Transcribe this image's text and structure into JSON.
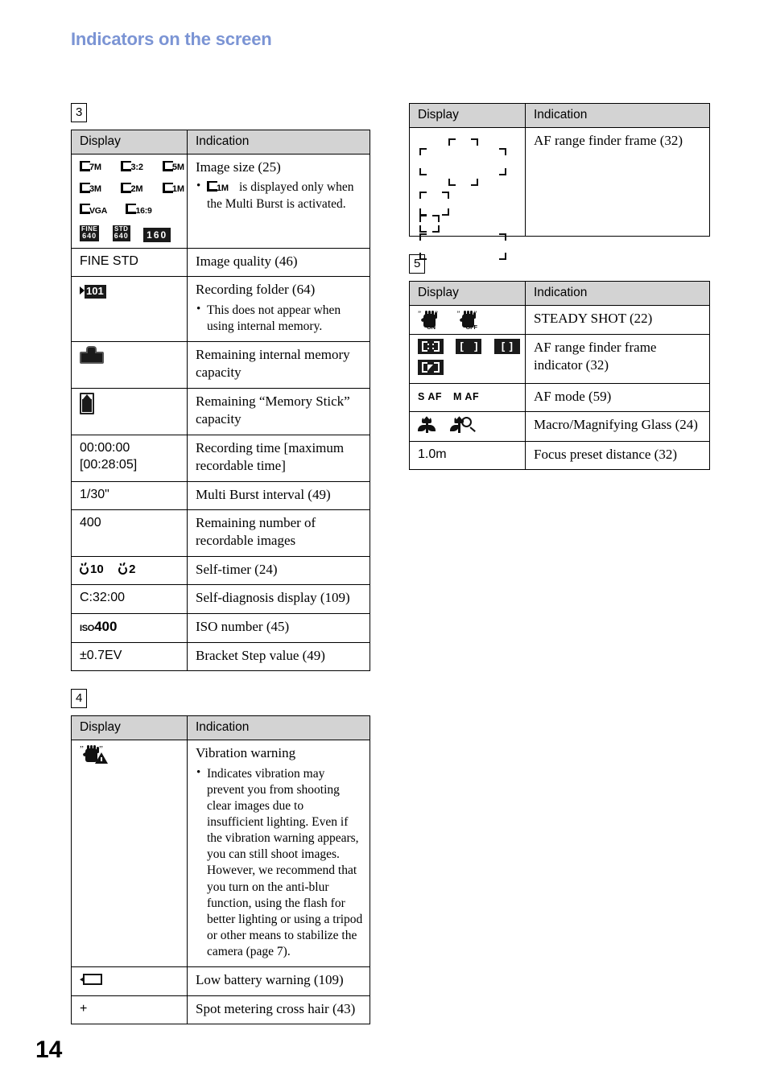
{
  "header": {
    "title": "Indicators on the screen"
  },
  "page_number": "14",
  "accent_color": "#7b94d4",
  "header_row_bg": "#d3d3d3",
  "columns": {
    "headers": {
      "display": "Display",
      "indication": "Indication"
    }
  },
  "sections": [
    {
      "number": "3",
      "rows": [
        {
          "display_kind": "image-size-icons",
          "display_icons": [
            "size-7M",
            "size-3:2",
            "size-5M",
            "size-3M",
            "size-2M",
            "size-1M",
            "size-VGA",
            "size-16:9",
            "movie-fine-640",
            "movie-std-640",
            "movie-160"
          ],
          "icon_labels": [
            "7M",
            "3:2",
            "5M",
            "3M",
            "2M",
            "1M",
            "VGA",
            "16:9"
          ],
          "chip_labels": [
            {
              "top": "FINE",
              "bottom": "640"
            },
            {
              "top": "STD",
              "bottom": "640"
            },
            {
              "single": "160"
            }
          ],
          "indication": "Image size (25)",
          "bullets": [
            "is displayed only when the Multi Burst is activated."
          ],
          "bullet_icon_label": "1M"
        },
        {
          "display_kind": "text",
          "display": "FINE STD",
          "indication": "Image quality (46)"
        },
        {
          "display_kind": "folder-icon",
          "display": "101",
          "indication": "Recording folder (64)",
          "bullets": [
            "This does not appear when using internal memory."
          ]
        },
        {
          "display_kind": "internal-memory-icon",
          "display": "",
          "indication": "Remaining internal memory capacity"
        },
        {
          "display_kind": "memory-stick-icon",
          "display": "",
          "indication": "Remaining “Memory Stick” capacity"
        },
        {
          "display_kind": "text2",
          "display_line1": "00:00:00",
          "display_line2": "[00:28:05]",
          "indication": "Recording time [maximum recordable time]"
        },
        {
          "display_kind": "text",
          "display": "1/30\"",
          "indication": "Multi Burst interval (49)"
        },
        {
          "display_kind": "text",
          "display": "400",
          "indication": "Remaining number of recordable images"
        },
        {
          "display_kind": "self-timer-icons",
          "timer_values": [
            "10",
            "2"
          ],
          "indication": "Self-timer (24)"
        },
        {
          "display_kind": "text",
          "display": "C:32:00",
          "indication": "Self-diagnosis display (109)"
        },
        {
          "display_kind": "iso-icon",
          "iso_prefix": "ISO",
          "iso_value": "400",
          "indication": "ISO number (45)"
        },
        {
          "display_kind": "text",
          "display": "±0.7EV",
          "indication": "Bracket Step value (49)"
        }
      ]
    },
    {
      "number": "4",
      "rows": [
        {
          "display_kind": "vibration-warning-icon",
          "display": "",
          "indication": "Vibration warning",
          "bullets": [
            "Indicates vibration may prevent you from shooting clear images due to insufficient lighting. Even if the vibration warning appears, you can still shoot images. However, we recommend that you turn on the anti-blur function, using the flash for better lighting or using a tripod or other means to stabilize the camera (page 7)."
          ]
        },
        {
          "display_kind": "low-battery-icon",
          "display": "",
          "indication": "Low battery warning (109)"
        },
        {
          "display_kind": "text",
          "display": "+",
          "indication": "Spot metering cross hair (43)"
        }
      ]
    },
    {
      "number": "",
      "position": "right-top",
      "rows": [
        {
          "display_kind": "af-frame-art",
          "display": "",
          "indication": "AF range finder frame (32)"
        }
      ]
    },
    {
      "number": "5",
      "rows": [
        {
          "display_kind": "steadyshot-icons",
          "steady_labels": [
            "ON",
            "OFF"
          ],
          "indication": "STEADY SHOT (22)"
        },
        {
          "display_kind": "af-indicator-chips",
          "chips": [
            "af-multi-frame",
            "af-wide-brackets",
            "af-narrow-brackets",
            "af-flexible-spot"
          ],
          "indication": "AF range finder frame indicator (32)"
        },
        {
          "display_kind": "af-mode-text",
          "af_modes": [
            "S AF",
            "M AF"
          ],
          "indication": "AF mode (59)"
        },
        {
          "display_kind": "macro-icons",
          "indication": "Macro/Magnifying Glass (24)"
        },
        {
          "display_kind": "text",
          "display": "1.0m",
          "indication": "Focus preset distance (32)"
        }
      ]
    }
  ]
}
